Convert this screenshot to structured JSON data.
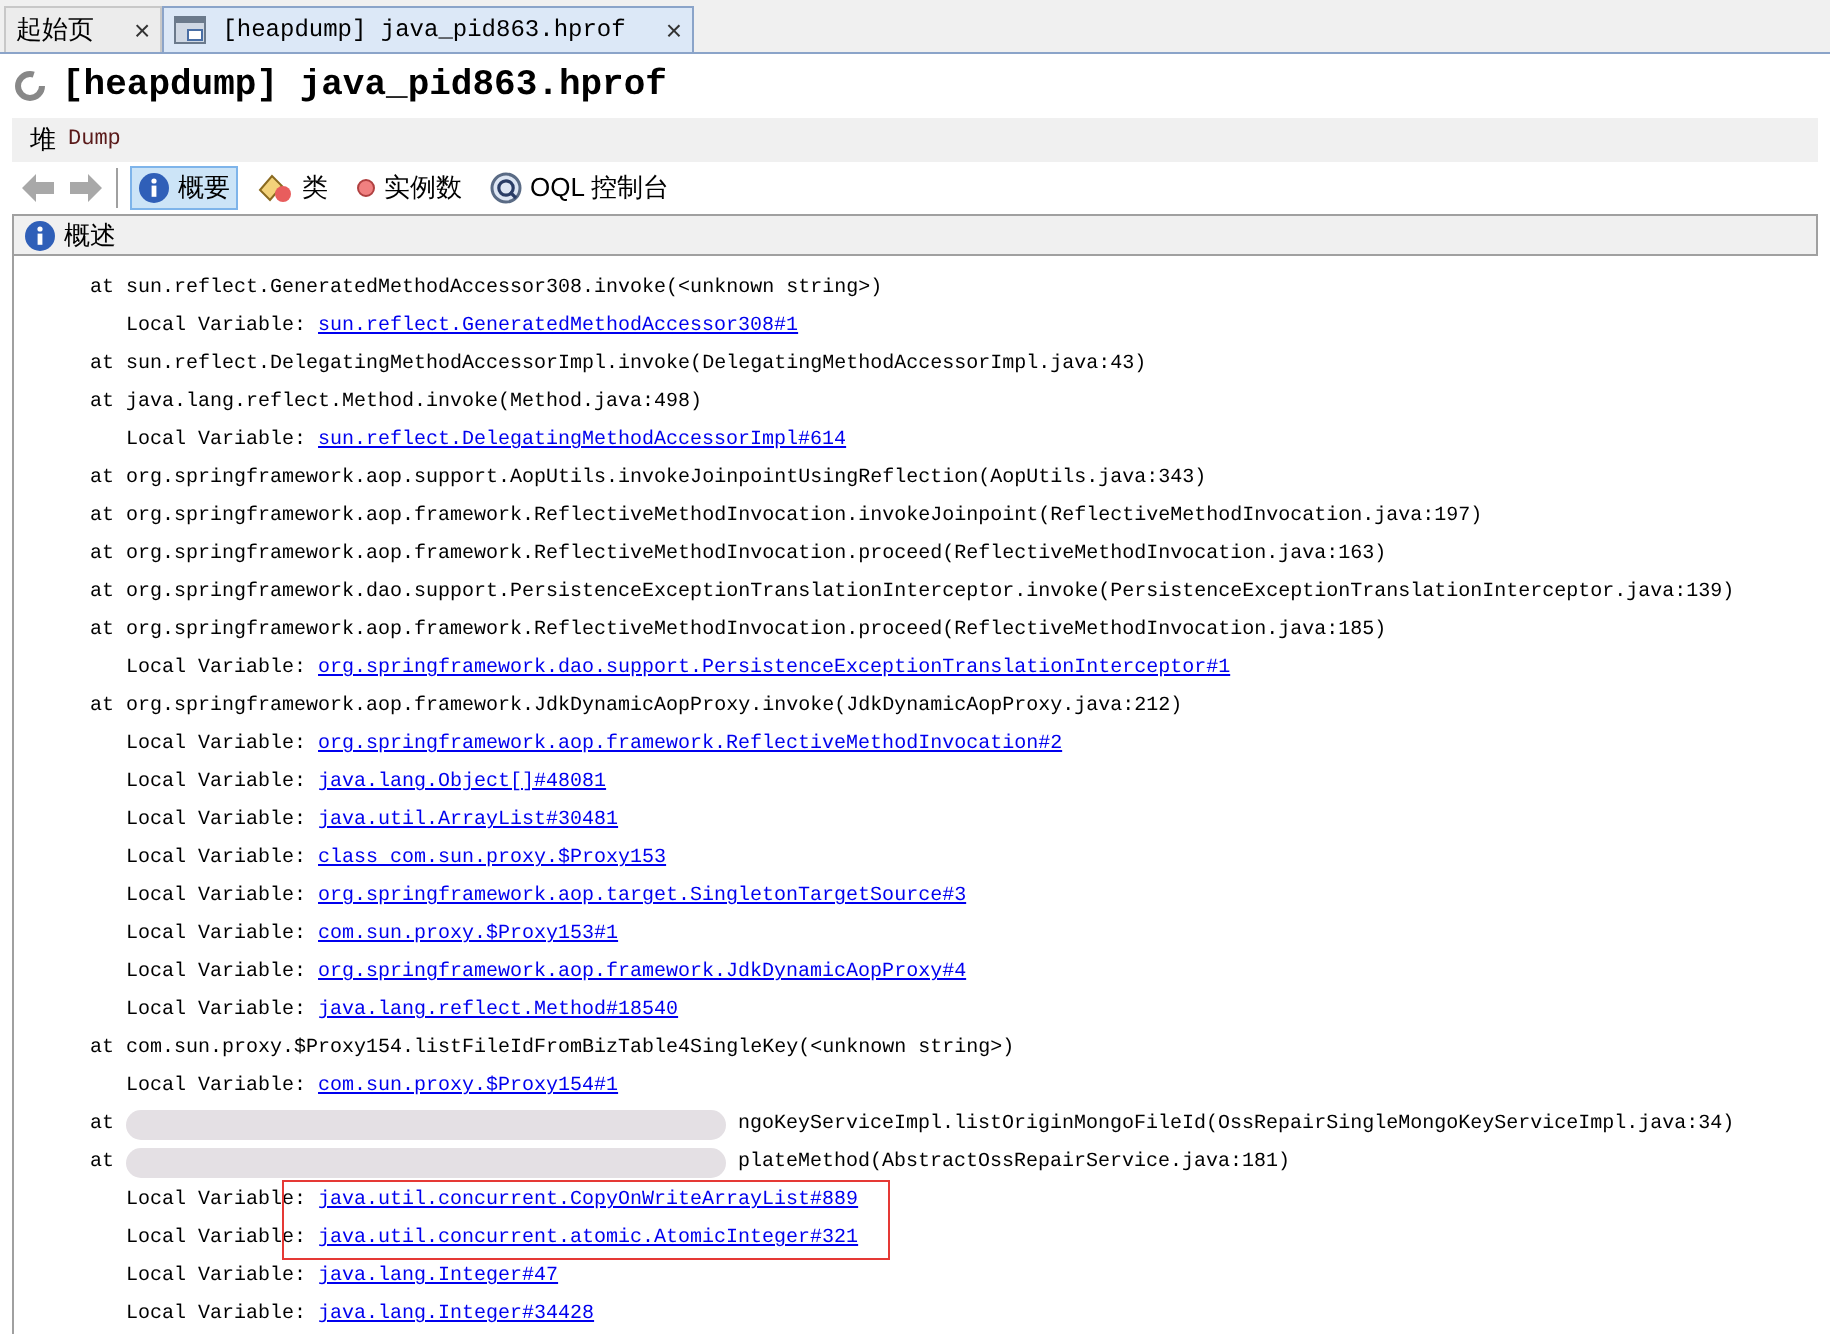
{
  "tabs": [
    {
      "label": "起始页",
      "selected": false,
      "close": "×"
    },
    {
      "label": "[heapdump] java_pid863.hprof",
      "selected": true,
      "close": "×"
    }
  ],
  "title": "[heapdump] java_pid863.hprof",
  "breadcrumb": {
    "prefix": "堆",
    "label": "Dump"
  },
  "toolbar": [
    {
      "label": "概要",
      "kind": "info",
      "selected": true
    },
    {
      "label": "类",
      "kind": "classes",
      "selected": false
    },
    {
      "label": "实例数",
      "kind": "instances",
      "selected": false
    },
    {
      "label": "OQL 控制台",
      "kind": "oql",
      "selected": false
    }
  ],
  "section": {
    "title": "概述"
  },
  "lines": [
    {
      "kind": "frame",
      "prefix": "at",
      "text": "sun.reflect.GeneratedMethodAccessor308.invoke(<unknown string>)",
      "redacted": false
    },
    {
      "kind": "local",
      "label": "Local Variable:",
      "link": "sun.reflect.GeneratedMethodAccessor308#1",
      "highlighted": false
    },
    {
      "kind": "frame",
      "prefix": "at",
      "text": "sun.reflect.DelegatingMethodAccessorImpl.invoke(DelegatingMethodAccessorImpl.java:43)",
      "redacted": false
    },
    {
      "kind": "frame",
      "prefix": "at",
      "text": "java.lang.reflect.Method.invoke(Method.java:498)",
      "redacted": false
    },
    {
      "kind": "local",
      "label": "Local Variable:",
      "link": "sun.reflect.DelegatingMethodAccessorImpl#614",
      "highlighted": false
    },
    {
      "kind": "frame",
      "prefix": "at",
      "text": "org.springframework.aop.support.AopUtils.invokeJoinpointUsingReflection(AopUtils.java:343)",
      "redacted": false
    },
    {
      "kind": "frame",
      "prefix": "at",
      "text": "org.springframework.aop.framework.ReflectiveMethodInvocation.invokeJoinpoint(ReflectiveMethodInvocation.java:197)",
      "redacted": false
    },
    {
      "kind": "frame",
      "prefix": "at",
      "text": "org.springframework.aop.framework.ReflectiveMethodInvocation.proceed(ReflectiveMethodInvocation.java:163)",
      "redacted": false
    },
    {
      "kind": "frame",
      "prefix": "at",
      "text": "org.springframework.dao.support.PersistenceExceptionTranslationInterceptor.invoke(PersistenceExceptionTranslationInterceptor.java:139)",
      "redacted": false
    },
    {
      "kind": "frame",
      "prefix": "at",
      "text": "org.springframework.aop.framework.ReflectiveMethodInvocation.proceed(ReflectiveMethodInvocation.java:185)",
      "redacted": false
    },
    {
      "kind": "local",
      "label": "Local Variable:",
      "link": "org.springframework.dao.support.PersistenceExceptionTranslationInterceptor#1",
      "highlighted": false
    },
    {
      "kind": "frame",
      "prefix": "at",
      "text": "org.springframework.aop.framework.JdkDynamicAopProxy.invoke(JdkDynamicAopProxy.java:212)",
      "redacted": false
    },
    {
      "kind": "local",
      "label": "Local Variable:",
      "link": "org.springframework.aop.framework.ReflectiveMethodInvocation#2",
      "highlighted": false
    },
    {
      "kind": "local",
      "label": "Local Variable:",
      "link": "java.lang.Object[]#48081",
      "highlighted": false
    },
    {
      "kind": "local",
      "label": "Local Variable:",
      "link": "java.util.ArrayList#30481",
      "highlighted": false
    },
    {
      "kind": "local",
      "label": "Local Variable:",
      "link": "class com.sun.proxy.$Proxy153",
      "highlighted": false
    },
    {
      "kind": "local",
      "label": "Local Variable:",
      "link": "org.springframework.aop.target.SingletonTargetSource#3",
      "highlighted": false
    },
    {
      "kind": "local",
      "label": "Local Variable:",
      "link": "com.sun.proxy.$Proxy153#1",
      "highlighted": false
    },
    {
      "kind": "local",
      "label": "Local Variable:",
      "link": "org.springframework.aop.framework.JdkDynamicAopProxy#4",
      "highlighted": false
    },
    {
      "kind": "local",
      "label": "Local Variable:",
      "link": "java.lang.reflect.Method#18540",
      "highlighted": false
    },
    {
      "kind": "frame",
      "prefix": "at",
      "text": "com.sun.proxy.$Proxy154.listFileIdFromBizTable4SingleKey(<unknown string>)",
      "redacted": false
    },
    {
      "kind": "local",
      "label": "Local Variable:",
      "link": "com.sun.proxy.$Proxy154#1",
      "highlighted": false
    },
    {
      "kind": "frame",
      "prefix": "at",
      "text": "ngoKeyServiceImpl.listOriginMongoFileId(OssRepairSingleMongoKeyServiceImpl.java:34)",
      "redacted": true
    },
    {
      "kind": "frame",
      "prefix": "at",
      "text": "plateMethod(AbstractOssRepairService.java:181)",
      "redacted": true
    },
    {
      "kind": "local",
      "label": "Local Variable:",
      "link": "java.util.concurrent.CopyOnWriteArrayList#889",
      "highlighted": true
    },
    {
      "kind": "local",
      "label": "Local Variable:",
      "link": "java.util.concurrent.atomic.AtomicInteger#321",
      "highlighted": true
    },
    {
      "kind": "local",
      "label": "Local Variable:",
      "link": "java.lang.Integer#47",
      "highlighted": false
    },
    {
      "kind": "local",
      "label": "Local Variable:",
      "link": "java.lang.Integer#34428",
      "highlighted": false
    }
  ]
}
